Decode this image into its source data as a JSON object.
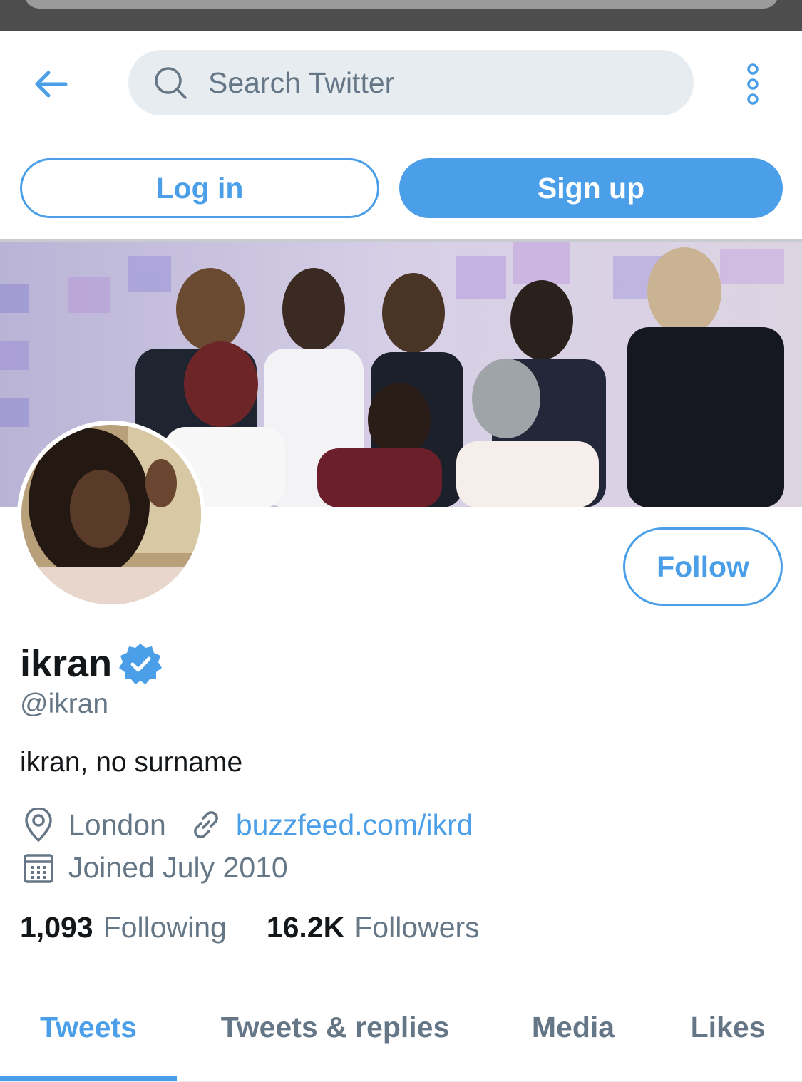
{
  "header": {
    "search_placeholder": "Search Twitter"
  },
  "auth": {
    "login_label": "Log in",
    "signup_label": "Sign up"
  },
  "profile": {
    "display_name": "ikran",
    "verified": true,
    "handle": "@ikran",
    "bio": "ikran, no surname",
    "location": "London",
    "website": "buzzfeed.com/ikrd",
    "joined": "Joined July 2010",
    "follow_label": "Follow",
    "following_count": "1,093",
    "following_label": "Following",
    "followers_count": "16.2K",
    "followers_label": "Followers"
  },
  "tabs": [
    {
      "label": "Tweets",
      "active": true
    },
    {
      "label": "Tweets & replies",
      "active": false
    },
    {
      "label": "Media",
      "active": false
    },
    {
      "label": "Likes",
      "active": false
    }
  ],
  "colors": {
    "accent": "#4a9fe8",
    "secondary_text": "#657786",
    "primary_text": "#14171a",
    "search_bg": "#e6ecf0"
  },
  "icons": {
    "back": "arrow-left-icon",
    "search": "search-icon",
    "more": "more-vertical-icon",
    "verified": "verified-badge-icon",
    "location": "location-pin-icon",
    "link": "link-icon",
    "calendar": "calendar-icon"
  }
}
